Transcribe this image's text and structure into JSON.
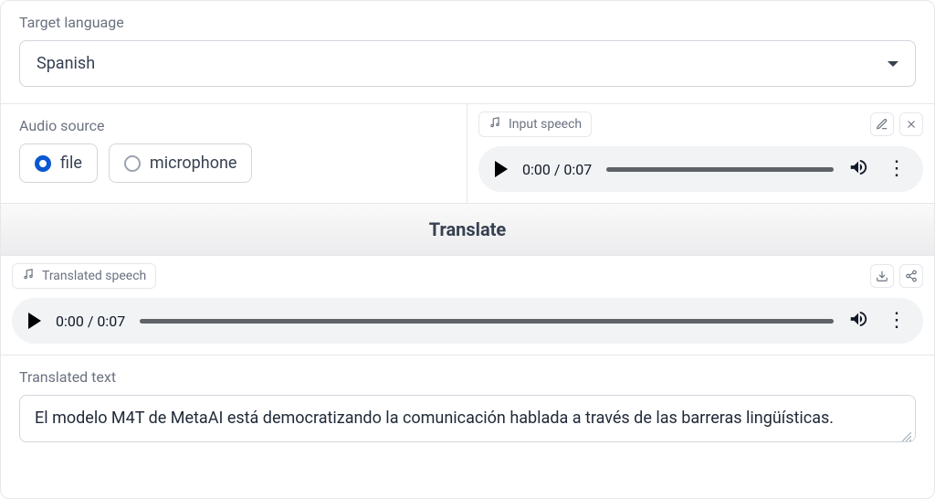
{
  "target_language": {
    "label": "Target language",
    "selected": "Spanish"
  },
  "audio_source": {
    "label": "Audio source",
    "options": {
      "file": "file",
      "microphone": "microphone"
    },
    "selected": "file"
  },
  "input_speech": {
    "label": "Input speech",
    "current_time": "0:00",
    "duration": "0:07"
  },
  "translate_button": "Translate",
  "translated_speech": {
    "label": "Translated speech",
    "current_time": "0:00",
    "duration": "0:07"
  },
  "translated_text": {
    "label": "Translated text",
    "value": "El modelo M4T de MetaAI está democratizando la comunicación hablada a través de las barreras lingüísticas."
  }
}
